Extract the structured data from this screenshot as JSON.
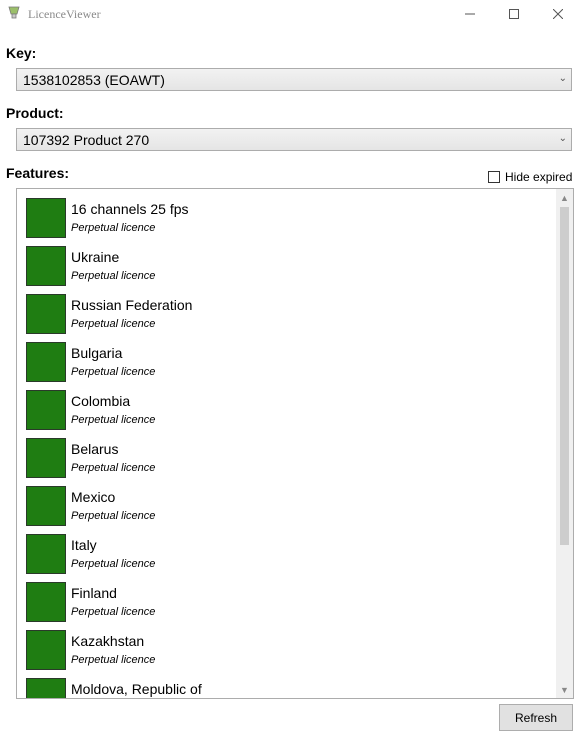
{
  "window": {
    "title": "LicenceViewer",
    "min_icon": "minimize-icon",
    "max_icon": "maximize-icon",
    "close_icon": "close-icon"
  },
  "key": {
    "label": "Key:",
    "value": "1538102853 (EOAWT)"
  },
  "product": {
    "label": "Product:",
    "value": "107392 Product 270"
  },
  "features": {
    "label": "Features:",
    "hide_expired_label": "Hide expired",
    "hide_expired_checked": false,
    "items": [
      {
        "name": "16 channels 25 fps",
        "status": "Perpetual licence"
      },
      {
        "name": "Ukraine",
        "status": "Perpetual licence"
      },
      {
        "name": "Russian Federation",
        "status": "Perpetual licence"
      },
      {
        "name": "Bulgaria",
        "status": "Perpetual licence"
      },
      {
        "name": "Colombia",
        "status": "Perpetual licence"
      },
      {
        "name": "Belarus",
        "status": "Perpetual licence"
      },
      {
        "name": "Mexico",
        "status": "Perpetual licence"
      },
      {
        "name": "Italy",
        "status": "Perpetual licence"
      },
      {
        "name": "Finland",
        "status": "Perpetual licence"
      },
      {
        "name": "Kazakhstan",
        "status": "Perpetual licence"
      },
      {
        "name": "Moldova, Republic of",
        "status": ""
      }
    ]
  },
  "refresh_label": "Refresh",
  "colors": {
    "swatch": "#1f7d12"
  }
}
